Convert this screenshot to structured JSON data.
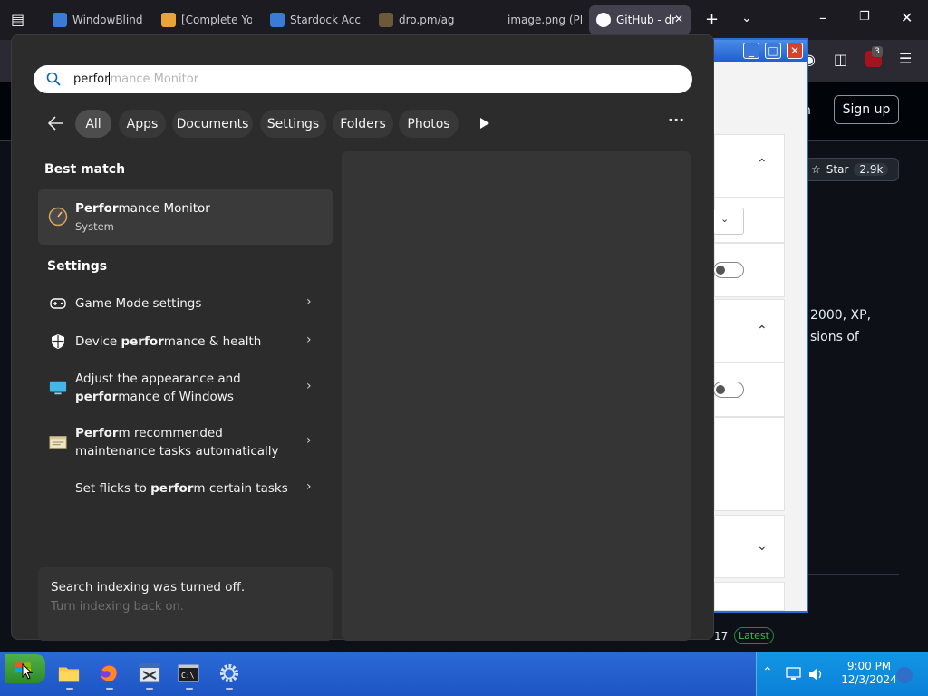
{
  "browser": {
    "tabs": [
      {
        "title": "WindowBlind",
        "favicon_color": "#3a7bd5"
      },
      {
        "title": "[Complete Yo",
        "favicon_color": "#e8a33b"
      },
      {
        "title": "Stardock Acce",
        "favicon_color": "#3a7bd5"
      },
      {
        "title": "dro.pm/ag",
        "favicon_color": "#6b5a3a"
      },
      {
        "title": "image.png (PNG I",
        "favicon_color": "#1c1b22"
      },
      {
        "title": "GitHub - dr",
        "favicon_color": "#fbfbfe",
        "active": true
      }
    ],
    "tab_close_glyph": "✕",
    "new_tab_glyph": "+",
    "extension_badge": "3"
  },
  "github": {
    "signin_fragment": "n",
    "signup_label": "Sign up",
    "star_label": "Star",
    "star_count": "2.9k",
    "desc_line1": "2000, XP,",
    "desc_line2": "sions of",
    "release_fragment": "17",
    "latest_badge": "Latest"
  },
  "search": {
    "typed": "perfor",
    "ghost": "mance Monitor",
    "filters": [
      "All",
      "Apps",
      "Documents",
      "Settings",
      "Folders",
      "Photos"
    ],
    "active_filter": "All"
  },
  "results": {
    "best_match_heading": "Best match",
    "best_match": {
      "bold": "Perfor",
      "rest": "mance Monitor",
      "sub": "System"
    },
    "settings_heading": "Settings",
    "settings_items": [
      {
        "pre": "Game Mode settings",
        "bold": "",
        "post": "",
        "line2_bold": "",
        "line2_post": ""
      },
      {
        "pre": "Device ",
        "bold": "perfor",
        "post": "mance & health",
        "line2_bold": "",
        "line2_post": ""
      },
      {
        "pre": "Adjust the appearance and",
        "bold": "",
        "post": "",
        "line2_bold": "perfor",
        "line2_post": "mance of Windows"
      },
      {
        "pre": "",
        "bold": "Perfor",
        "post": "m recommended",
        "line2_bold": "",
        "line2_post": "maintenance tasks automatically"
      },
      {
        "pre": "Set flicks to ",
        "bold": "perfor",
        "post": "m certain tasks",
        "line2_bold": "",
        "line2_post": ""
      }
    ],
    "indexing_text": "Search indexing was turned off.",
    "indexing_link": "Turn indexing back on."
  },
  "taskbar": {
    "time": "9:00 PM",
    "date": "12/3/2024",
    "colors": {
      "bar": "#1d55c4",
      "tray": "#0b80d6",
      "start": "#3a9a35"
    }
  }
}
